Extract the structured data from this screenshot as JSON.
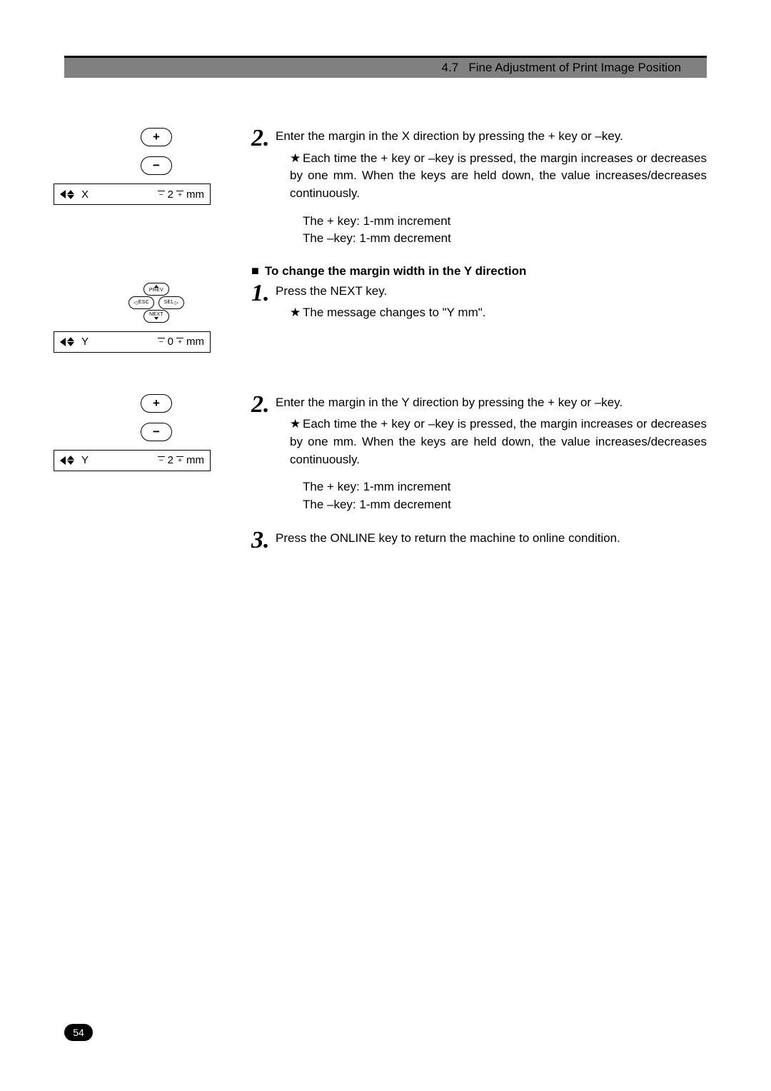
{
  "header": {
    "section_number": "4.7",
    "section_title": "Fine Adjustment of Print Image Position"
  },
  "page_number": "54",
  "lcd_displays": {
    "x_2": {
      "axis": "X",
      "value": "2",
      "unit": "mm"
    },
    "y_0": {
      "axis": "Y",
      "value": "0",
      "unit": "mm"
    },
    "y_2": {
      "axis": "Y",
      "value": "2",
      "unit": "mm"
    }
  },
  "buttons": {
    "plus": "+",
    "minus": "−",
    "prev": "PREV",
    "next": "NEXT",
    "esc": "ESC",
    "sel": "SEL"
  },
  "steps": {
    "x_step2": {
      "num": "2.",
      "text": "Enter the margin in the X direction by pressing the + key or –key.",
      "bullet": "Each time the + key or –key is pressed, the margin increases or decreases by one mm.  When the keys are held down, the value increases/decreases continuously.",
      "inc": "The + key:   1-mm increment",
      "dec": "The –key:   1-mm decrement"
    },
    "y_heading": "To change the margin width in the Y direction",
    "y_step1": {
      "num": "1.",
      "text": "Press the NEXT key.",
      "bullet": "The message changes to \"Y mm\"."
    },
    "y_step2": {
      "num": "2.",
      "text": "Enter the margin in the Y direction by pressing the + key or –key.",
      "bullet": "Each time the + key or –key is pressed, the margin increases or decreases by one mm.  When the keys are held down, the value increases/decreases continuously.",
      "inc": "The + key:   1-mm increment",
      "dec": "The –key:   1-mm decrement"
    },
    "step3": {
      "num": "3.",
      "text": "Press the ONLINE key to return the machine to online condition."
    }
  },
  "star": "★"
}
